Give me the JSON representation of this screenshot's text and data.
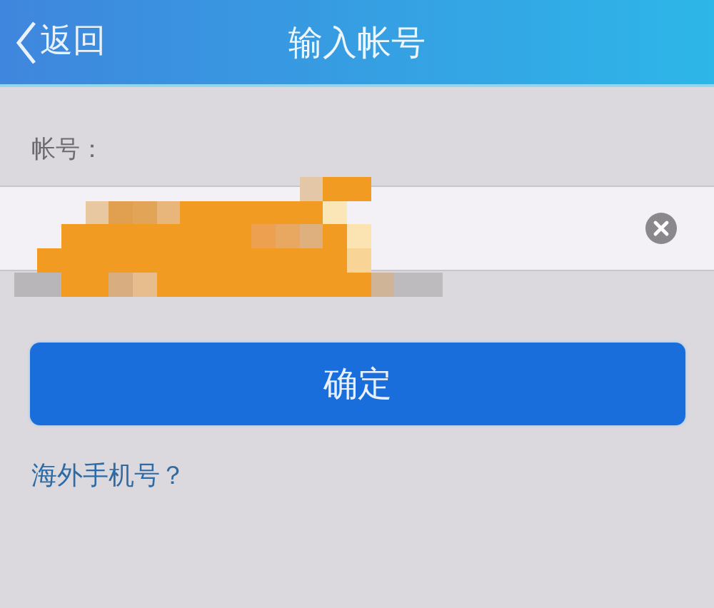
{
  "nav_bar": {
    "back_label": "返回",
    "title": "输入帐号"
  },
  "account_field": {
    "label": "帐号：",
    "value_obscured": true
  },
  "buttons": [
    {
      "label": "确定"
    }
  ],
  "overseas_link": "海外手机号？"
}
